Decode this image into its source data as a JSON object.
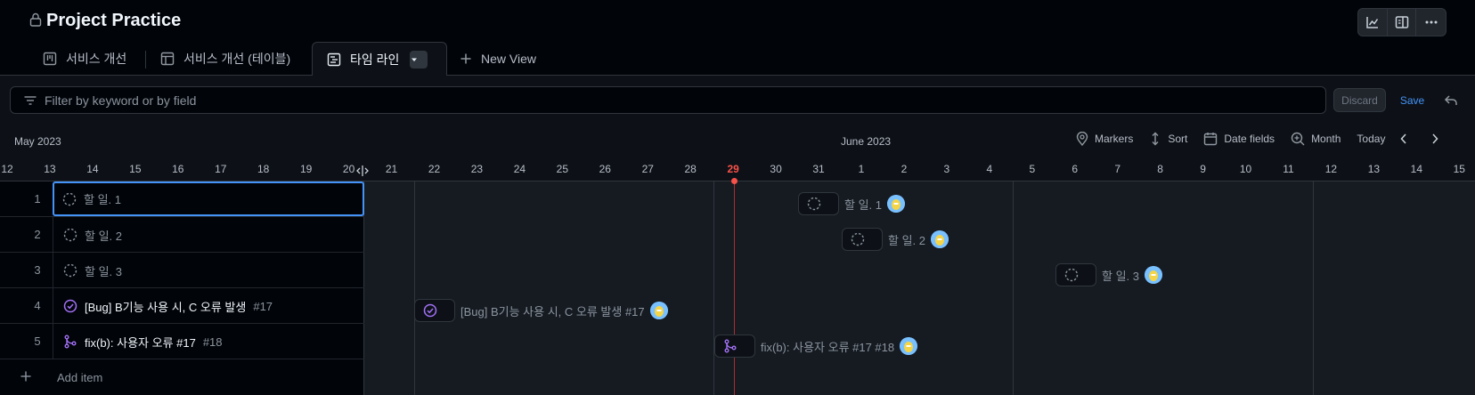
{
  "header": {
    "title": "Project Practice",
    "actions": [
      "insights-icon",
      "sidebar-icon",
      "kebab-icon"
    ]
  },
  "tabs": [
    {
      "label": "서비스 개선",
      "icon": "board-icon"
    },
    {
      "label": "서비스 개선 (테이블)",
      "icon": "table-icon"
    },
    {
      "label": "타임 라인",
      "icon": "roadmap-icon",
      "active": true
    },
    {
      "label": "New View",
      "icon": "plus-icon"
    }
  ],
  "filter": {
    "placeholder": "Filter by keyword or by field",
    "discard_label": "Discard",
    "save_label": "Save"
  },
  "timeline": {
    "months": [
      "May 2023",
      "June 2023"
    ],
    "toolbar": {
      "markers": "Markers",
      "sort": "Sort",
      "date_fields": "Date fields",
      "zoom": "Month",
      "today": "Today"
    },
    "days": [
      "12",
      "13",
      "14",
      "15",
      "16",
      "17",
      "18",
      "19",
      "20",
      "21",
      "22",
      "23",
      "24",
      "25",
      "26",
      "27",
      "28",
      "29",
      "30",
      "31",
      "1",
      "2",
      "3",
      "4",
      "5",
      "6",
      "7",
      "8",
      "9",
      "10",
      "11",
      "12",
      "13",
      "14",
      "15"
    ],
    "today": "29"
  },
  "rows": [
    {
      "num": "1",
      "title": "할 일. 1",
      "type": "draft"
    },
    {
      "num": "2",
      "title": "할 일. 2",
      "type": "draft"
    },
    {
      "num": "3",
      "title": "할 일. 3",
      "type": "draft"
    },
    {
      "num": "4",
      "title": "[Bug] B기능 사용 시, C 오류 발생",
      "issue_num": "#17",
      "type": "issue-closed"
    },
    {
      "num": "5",
      "title": "fix(b): 사용자 오류 #17",
      "issue_num": "#18",
      "type": "pr-merged"
    }
  ],
  "add_item_label": "Add item",
  "timeline_items": [
    {
      "label": "할 일. 1"
    },
    {
      "label": "할 일. 2"
    },
    {
      "label": "할 일. 3"
    },
    {
      "label": "[Bug] B기능 사용 시, C 오류 발생 #17"
    },
    {
      "label": "fix(b): 사용자 오류 #17 #18"
    }
  ],
  "colors": {
    "accent": "#4493f8",
    "today": "#f85149",
    "done_purple": "#a371f7"
  }
}
